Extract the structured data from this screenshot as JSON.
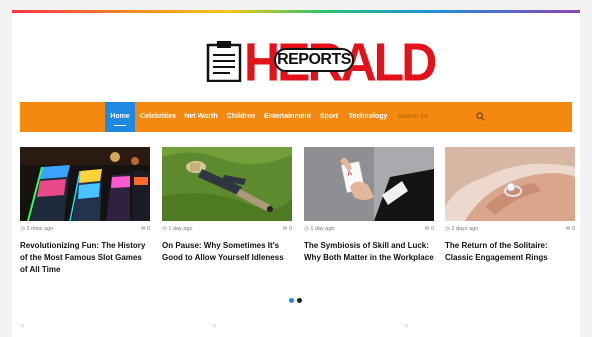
{
  "brand": {
    "logo_word": "HERALD",
    "logo_badge": "REPORTS",
    "accent_red": "#e3111a",
    "nav_orange": "#f5890f",
    "active_blue": "#1e89e0"
  },
  "nav": {
    "items": [
      {
        "label": "Home",
        "active": true
      },
      {
        "label": "Celebrities",
        "active": false
      },
      {
        "label": "Net Worth",
        "active": false
      },
      {
        "label": "Children",
        "active": false
      },
      {
        "label": "Entertainment",
        "active": false
      },
      {
        "label": "Sport",
        "active": false
      },
      {
        "label": "Technology",
        "active": false
      }
    ],
    "search_placeholder": "Search for",
    "search_icon": "search-icon"
  },
  "posts": [
    {
      "time": "3 mins ago",
      "comments": "0",
      "title": "Revolutionizing Fun: The History of the Most Famous Slot Games of All Time",
      "image": "slot-machines"
    },
    {
      "time": "1 day ago",
      "comments": "0",
      "title": "On Pause: Why Sometimes It's Good to Allow Yourself Idleness",
      "image": "man-lying-on-grass"
    },
    {
      "time": "1 day ago",
      "comments": "0",
      "title": "The Symbiosis of Skill and Luck: Why Both Matter in the Workplace",
      "image": "hand-holding-ace"
    },
    {
      "time": "2 days ago",
      "comments": "0",
      "title": "The Return of the Solitaire: Classic Engagement Rings",
      "image": "engagement-ring-hand"
    }
  ],
  "slider": {
    "dots": 2,
    "active": 0
  }
}
